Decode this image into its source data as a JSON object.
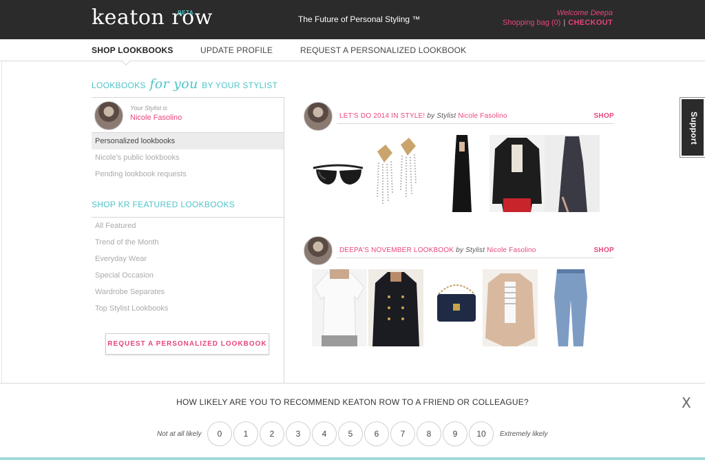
{
  "header": {
    "logo": "keaton row",
    "beta": "BETA",
    "tagline": "The Future of Personal Styling ™",
    "welcome": "Welcome Deepa",
    "bag": "Shopping bag (0)",
    "separator": "|",
    "checkout": "CHECKOUT"
  },
  "nav": {
    "items": [
      {
        "label": "SHOP LOOKBOOKS",
        "active": true
      },
      {
        "label": "UPDATE PROFILE",
        "active": false
      },
      {
        "label": "REQUEST A PERSONALIZED LOOKBOOK",
        "active": false
      }
    ]
  },
  "sidebar": {
    "heading_pre": "LOOKBOOKS",
    "heading_script": "for you",
    "heading_post": "BY YOUR STYLIST",
    "your_stylist": "Your Stylist is",
    "stylist_name": "Nicole Fasolino",
    "personal_items": [
      "Personalized lookbooks",
      "Nicole's public lookbooks",
      "Pending lookbook requests"
    ],
    "featured_heading": "SHOP KR FEATURED LOOKBOOKS",
    "featured_items": [
      "All Featured",
      "Trend of the Month",
      "Everyday Wear",
      "Special Occasion",
      "Wardrobe Separates",
      "Top Stylist Lookbooks"
    ],
    "request_button": "REQUEST A PERSONALIZED LOOKBOOK"
  },
  "lookbooks": [
    {
      "title": "LET'S DO 2014 IN STYLE!",
      "by": "by Stylist",
      "stylist": "Nicole Fasolino",
      "shop": "SHOP",
      "products": [
        "sunglasses",
        "crystal-earrings",
        "black-gown",
        "leather-jacket",
        "sequin-maxi-dress"
      ]
    },
    {
      "title": "DEEPA'S NOVEMBER LOOKBOOK",
      "by": "by Stylist",
      "stylist": "Nicole Fasolino",
      "shop": "SHOP",
      "products": [
        "white-tee",
        "military-coat",
        "navy-crossbody-bag",
        "draped-jacket",
        "boyfriend-jeans"
      ]
    }
  ],
  "survey": {
    "question": "HOW LIKELY ARE YOU TO RECOMMEND KEATON ROW TO A FRIEND OR COLLEAGUE?",
    "low_label": "Not at all likely",
    "high_label": "Extremely likely",
    "scores": [
      "0",
      "1",
      "2",
      "3",
      "4",
      "5",
      "6",
      "7",
      "8",
      "9",
      "10"
    ],
    "close": "X"
  },
  "support": {
    "label": "Support"
  },
  "colors": {
    "accent_pink": "#e8457c",
    "accent_teal": "#4ec3c9",
    "header_bg": "#2b2b2b"
  }
}
